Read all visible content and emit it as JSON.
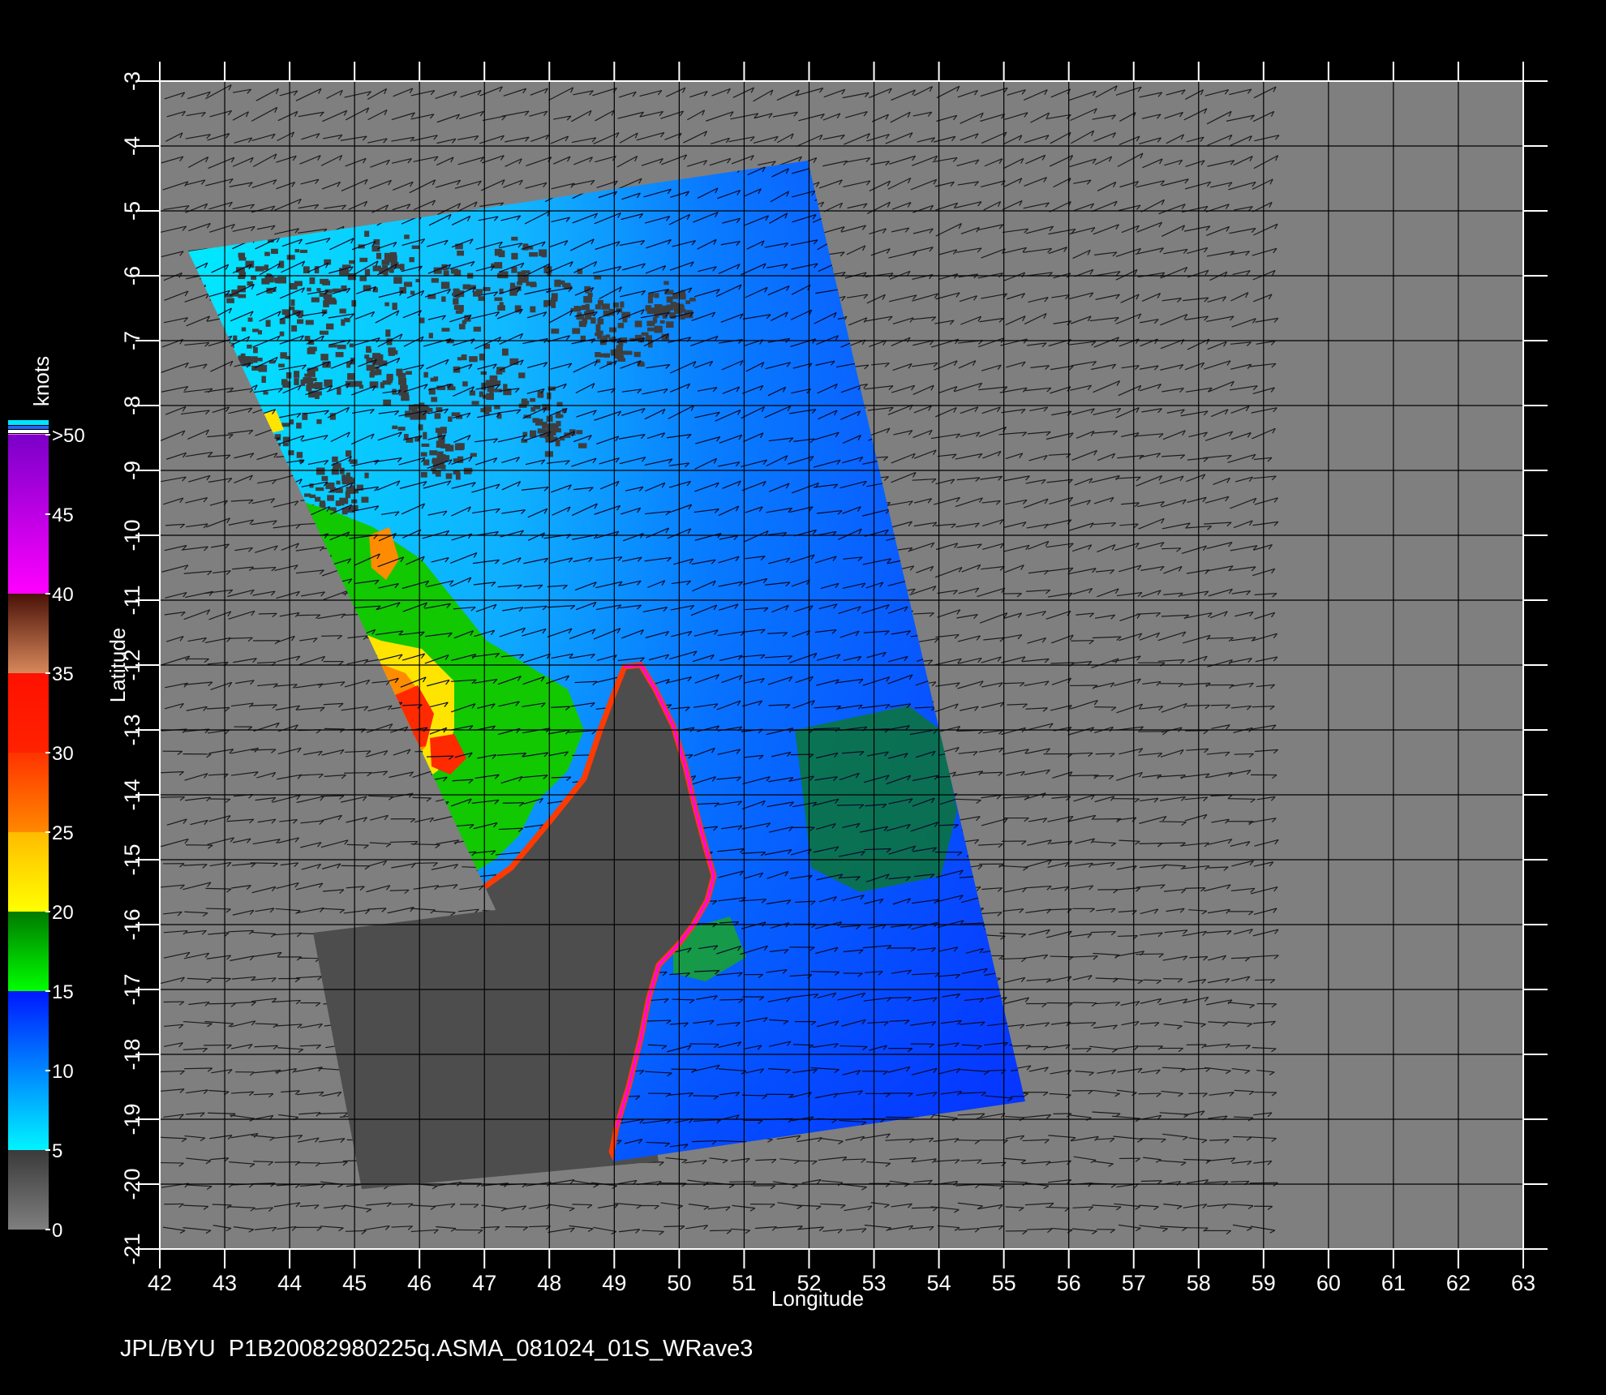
{
  "map": {
    "axes": {
      "x_label": "Longitude",
      "y_label": "Latitude",
      "x_ticks": [
        "42",
        "43",
        "44",
        "45",
        "46",
        "47",
        "48",
        "49",
        "50",
        "51",
        "52",
        "53",
        "54",
        "55",
        "56",
        "57",
        "58",
        "59",
        "60",
        "61",
        "62",
        "63"
      ],
      "y_ticks": [
        "-3",
        "-4",
        "-5",
        "-6",
        "-7",
        "-8",
        "-9",
        "-10",
        "-11",
        "-12",
        "-13",
        "-14",
        "-15",
        "-16",
        "-17",
        "-18",
        "-19",
        "-20",
        "-21"
      ],
      "x_range": [
        42,
        63
      ],
      "y_range": [
        -3,
        -21
      ],
      "grid": true
    },
    "colorbar": {
      "title": "knots",
      "labels": [
        ">50",
        "45",
        "40",
        "35",
        "30",
        "25",
        "20",
        "15",
        "10",
        "5",
        "0"
      ],
      "bands": [
        {
          "range": [
            0,
            5
          ],
          "top": "#3a3a3a",
          "bottom": "#7f7f7f"
        },
        {
          "range": [
            5,
            15
          ],
          "top": "#0018ff",
          "bottom": "#00f4ff"
        },
        {
          "range": [
            15,
            20
          ],
          "top": "#007a00",
          "bottom": "#00ff00"
        },
        {
          "range": [
            20,
            25
          ],
          "top": "#ffbb00",
          "bottom": "#ffff00"
        },
        {
          "range": [
            25,
            30
          ],
          "top": "#ff3300",
          "bottom": "#ff8800"
        },
        {
          "range": [
            30,
            35
          ],
          "top": "#ff1100",
          "bottom": "#ff2200"
        },
        {
          "range": [
            35,
            40
          ],
          "top": "#4a1208",
          "bottom": "#d8885a"
        },
        {
          "range": [
            40,
            50
          ],
          "top": "#7a00c8",
          "bottom": "#ff00ff"
        }
      ]
    },
    "colors": {
      "background": "#000000",
      "frame_fill": "#7f7f7f",
      "land": "#4d4d4d",
      "grid": "#000000",
      "arrows": "#1c1c1c",
      "text": "#ffffff"
    },
    "land_name": "",
    "footer": "JPL/BYU  P1B20082980225q.ASMA_081024_01S_WRave3"
  }
}
